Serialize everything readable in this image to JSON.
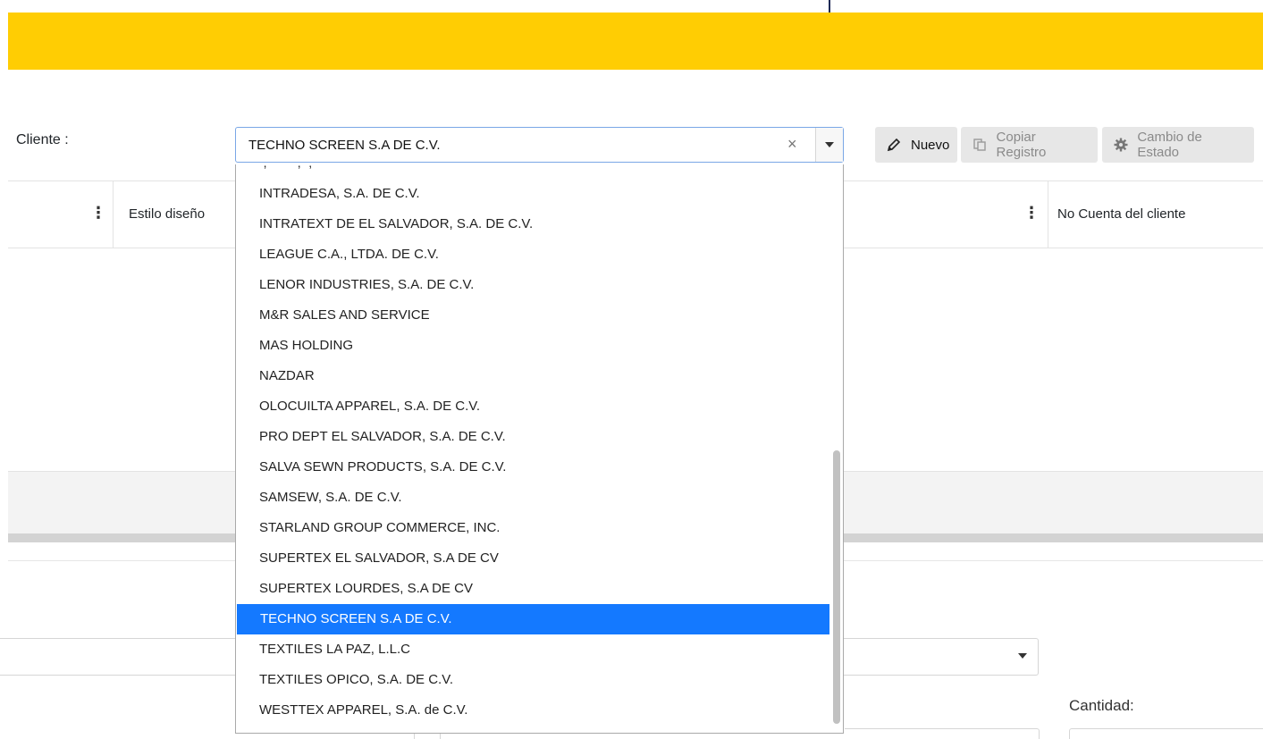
{
  "colors": {
    "banner": "#ffcd03",
    "selected_item": "#1479ff",
    "select_border": "#7aa7e6"
  },
  "form": {
    "cliente_label": "Cliente :",
    "cliente_value": "TECHNO SCREEN S.A DE C.V.",
    "clear_glyph": "×"
  },
  "toolbar": {
    "nuevo": "Nuevo",
    "copiar": "Copiar Registro",
    "estado": "Cambio de Estado"
  },
  "grid": {
    "columns": [
      "Estilo diseño",
      "No Cuenta del cliente"
    ],
    "menu_glyph": "⋮"
  },
  "dropdown": {
    "partial_top": "-, - - - -, ·, · - · - -",
    "items": [
      "INTRADESA, S.A. DE C.V.",
      "INTRATEXT DE EL SALVADOR, S.A. DE C.V.",
      "LEAGUE C.A., LTDA. DE C.V.",
      "LENOR INDUSTRIES, S.A. DE C.V.",
      "M&R SALES AND SERVICE",
      "MAS HOLDING",
      "NAZDAR",
      "OLOCUILTA APPAREL, S.A. DE C.V.",
      "PRO DEPT EL SALVADOR, S.A. DE C.V.",
      "SALVA SEWN PRODUCTS, S.A. DE C.V.",
      "SAMSEW, S.A. DE C.V.",
      "STARLAND GROUP COMMERCE, INC.",
      "SUPERTEX EL SALVADOR, S.A DE CV",
      "SUPERTEX LOURDES, S.A DE CV",
      "TECHNO SCREEN S.A DE C.V.",
      "TEXTILES LA PAZ, L.L.C",
      "TEXTILES OPICO, S.A. DE C.V.",
      "WESTTEX APPAREL, S.A. de C.V."
    ],
    "selected_index": 14
  },
  "bottom": {
    "cantidad_label": "Cantidad:"
  }
}
